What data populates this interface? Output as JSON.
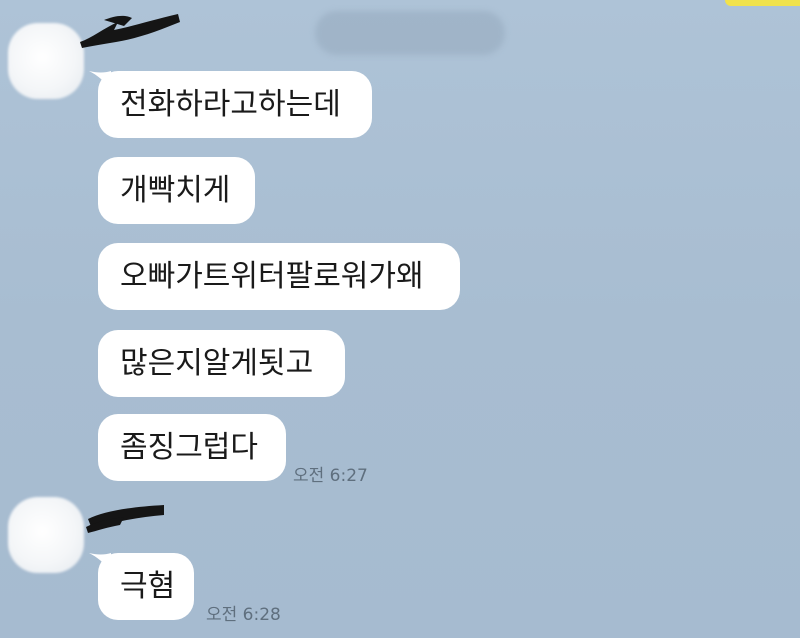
{
  "conversation": {
    "date_label": "",
    "groups": [
      {
        "messages": [
          "전화하라고하는데",
          "개빡치게",
          "오빠가트위터팔로워가왜",
          "많은지알게됫고",
          "좀징그럽다"
        ],
        "time": "오전 6:27"
      },
      {
        "messages": [
          "극혐"
        ],
        "time": "오전 6:28"
      }
    ]
  },
  "colors": {
    "background": "#a9bfd3",
    "bubble": "#ffffff",
    "timestamp": "#5f6f7e",
    "accent": "#f1e24c"
  }
}
